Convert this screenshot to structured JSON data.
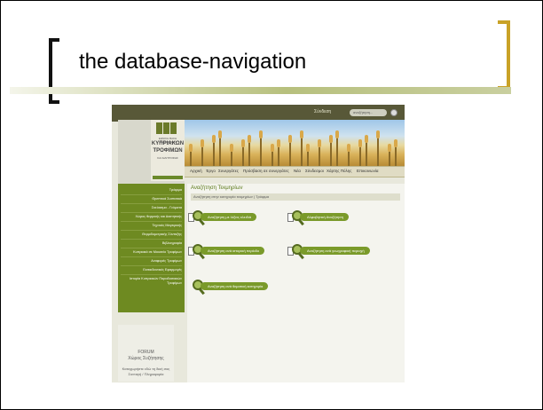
{
  "slide": {
    "title": "the database-navigation"
  },
  "site": {
    "topbar": {
      "login": "Σύνδεση",
      "search_placeholder": "αναζήτηση..."
    },
    "logo": {
      "small_top": "ΕΘΝΙΚΗ ΒΑΣΗ ΔΕΔΟΜΕΝΩΝ",
      "line1": "ΚΥΠΡΙΑΚΩΝ",
      "line2": "ΤΡΟΦΙΜΩΝ",
      "small_bottom": "ΚΑΙ ΔΙΑΙΤΡΟΦΗΣ"
    },
    "nav": [
      "Αρχική",
      "Έργο",
      "Συνεργάτες",
      "Πρόσβαση σε συνεργάτες",
      "Νέα",
      "Σύνδεσμοι",
      "Χάρτης Πύλης",
      "Επικοινωνία"
    ],
    "sidebar": [
      "Τρόφιμα",
      "Θρεπτικά Συστατικά",
      "Σκεύασμα - Γεύματα",
      "Χώρος θερμικής και Διαιτητικής",
      "Τεχνικές Μαγειρικής",
      "Θερμιδομετρικής Σύνταξης",
      "Βιβλιογραφία",
      "Κυπριακά σε Μουσείο Τροφίμων",
      "Αναφορές Τροφίμων",
      "Εκπαιδευτικές Εφαρμογές",
      "Ιστορία Κυπριακών Παραδοσιακών Τροφίμων"
    ],
    "forum": {
      "title": "FORUM",
      "subtitle": "Χώρος Συζήτησης",
      "note": "Καταχωρήστε εδώ τη δική σας Συνταγή / Πληροφορία"
    },
    "main": {
      "title": "Αναζήτηση Τεκμηρίων",
      "breadcrumb": "Αναζήτηση στην κατηγορία τεκμηρίων  |  Τρόφιμα",
      "options": [
        "Αναζήτηση με λέξεις κλειδιά",
        "Αλφαβητική Αναζήτηση",
        "Αναζήτηση ανά ιστορική περίοδο",
        "Αναζήτηση ανά γεωγραφική περιοχή",
        "Αναζήτηση ανά θεματική κατηγορία"
      ]
    }
  },
  "colors": {
    "accent_green": "#6e8a21",
    "bracket_gold": "#c9a227",
    "topbar": "#585838"
  }
}
